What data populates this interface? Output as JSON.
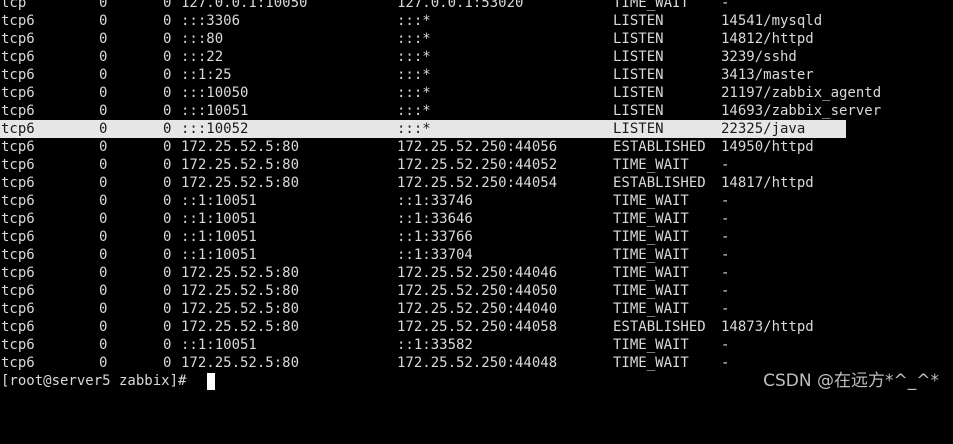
{
  "terminal": {
    "rows": [
      {
        "proto": "tcp",
        "recv_q": "0",
        "send_q": "0",
        "local": "127.0.0.1:10050",
        "foreign": "127.0.0.1:53020",
        "state": "TIME_WAIT",
        "pid": "-"
      },
      {
        "proto": "tcp6",
        "recv_q": "0",
        "send_q": "0",
        "local": ":::3306",
        "foreign": ":::*",
        "state": "LISTEN",
        "pid": "14541/mysqld"
      },
      {
        "proto": "tcp6",
        "recv_q": "0",
        "send_q": "0",
        "local": ":::80",
        "foreign": ":::*",
        "state": "LISTEN",
        "pid": "14812/httpd"
      },
      {
        "proto": "tcp6",
        "recv_q": "0",
        "send_q": "0",
        "local": ":::22",
        "foreign": ":::*",
        "state": "LISTEN",
        "pid": "3239/sshd"
      },
      {
        "proto": "tcp6",
        "recv_q": "0",
        "send_q": "0",
        "local": "::1:25",
        "foreign": ":::*",
        "state": "LISTEN",
        "pid": "3413/master"
      },
      {
        "proto": "tcp6",
        "recv_q": "0",
        "send_q": "0",
        "local": ":::10050",
        "foreign": ":::*",
        "state": "LISTEN",
        "pid": "21197/zabbix_agentd"
      },
      {
        "proto": "tcp6",
        "recv_q": "0",
        "send_q": "0",
        "local": ":::10051",
        "foreign": ":::*",
        "state": "LISTEN",
        "pid": "14693/zabbix_server"
      },
      {
        "proto": "tcp6",
        "recv_q": "0",
        "send_q": "0",
        "local": ":::10052",
        "foreign": ":::*",
        "state": "LISTEN",
        "pid": "22325/java",
        "highlighted": true
      },
      {
        "proto": "tcp6",
        "recv_q": "0",
        "send_q": "0",
        "local": "172.25.52.5:80",
        "foreign": "172.25.52.250:44056",
        "state": "ESTABLISHED",
        "pid": "14950/httpd"
      },
      {
        "proto": "tcp6",
        "recv_q": "0",
        "send_q": "0",
        "local": "172.25.52.5:80",
        "foreign": "172.25.52.250:44052",
        "state": "TIME_WAIT",
        "pid": "-"
      },
      {
        "proto": "tcp6",
        "recv_q": "0",
        "send_q": "0",
        "local": "172.25.52.5:80",
        "foreign": "172.25.52.250:44054",
        "state": "ESTABLISHED",
        "pid": "14817/httpd"
      },
      {
        "proto": "tcp6",
        "recv_q": "0",
        "send_q": "0",
        "local": "::1:10051",
        "foreign": "::1:33746",
        "state": "TIME_WAIT",
        "pid": "-"
      },
      {
        "proto": "tcp6",
        "recv_q": "0",
        "send_q": "0",
        "local": "::1:10051",
        "foreign": "::1:33646",
        "state": "TIME_WAIT",
        "pid": "-"
      },
      {
        "proto": "tcp6",
        "recv_q": "0",
        "send_q": "0",
        "local": "::1:10051",
        "foreign": "::1:33766",
        "state": "TIME_WAIT",
        "pid": "-"
      },
      {
        "proto": "tcp6",
        "recv_q": "0",
        "send_q": "0",
        "local": "::1:10051",
        "foreign": "::1:33704",
        "state": "TIME_WAIT",
        "pid": "-"
      },
      {
        "proto": "tcp6",
        "recv_q": "0",
        "send_q": "0",
        "local": "172.25.52.5:80",
        "foreign": "172.25.52.250:44046",
        "state": "TIME_WAIT",
        "pid": "-"
      },
      {
        "proto": "tcp6",
        "recv_q": "0",
        "send_q": "0",
        "local": "172.25.52.5:80",
        "foreign": "172.25.52.250:44050",
        "state": "TIME_WAIT",
        "pid": "-"
      },
      {
        "proto": "tcp6",
        "recv_q": "0",
        "send_q": "0",
        "local": "172.25.52.5:80",
        "foreign": "172.25.52.250:44040",
        "state": "TIME_WAIT",
        "pid": "-"
      },
      {
        "proto": "tcp6",
        "recv_q": "0",
        "send_q": "0",
        "local": "172.25.52.5:80",
        "foreign": "172.25.52.250:44058",
        "state": "ESTABLISHED",
        "pid": "14873/httpd"
      },
      {
        "proto": "tcp6",
        "recv_q": "0",
        "send_q": "0",
        "local": "::1:10051",
        "foreign": "::1:33582",
        "state": "TIME_WAIT",
        "pid": "-"
      },
      {
        "proto": "tcp6",
        "recv_q": "0",
        "send_q": "0",
        "local": "172.25.52.5:80",
        "foreign": "172.25.52.250:44048",
        "state": "TIME_WAIT",
        "pid": "-"
      }
    ],
    "prompt": "[root@server5 zabbix]# "
  },
  "watermark": "CSDN @在远方*^_^*",
  "colors": {
    "background": "#000000",
    "text": "#d9d9d9",
    "highlight_bg": "#e6e6e6",
    "highlight_text": "#1a1a1a"
  }
}
